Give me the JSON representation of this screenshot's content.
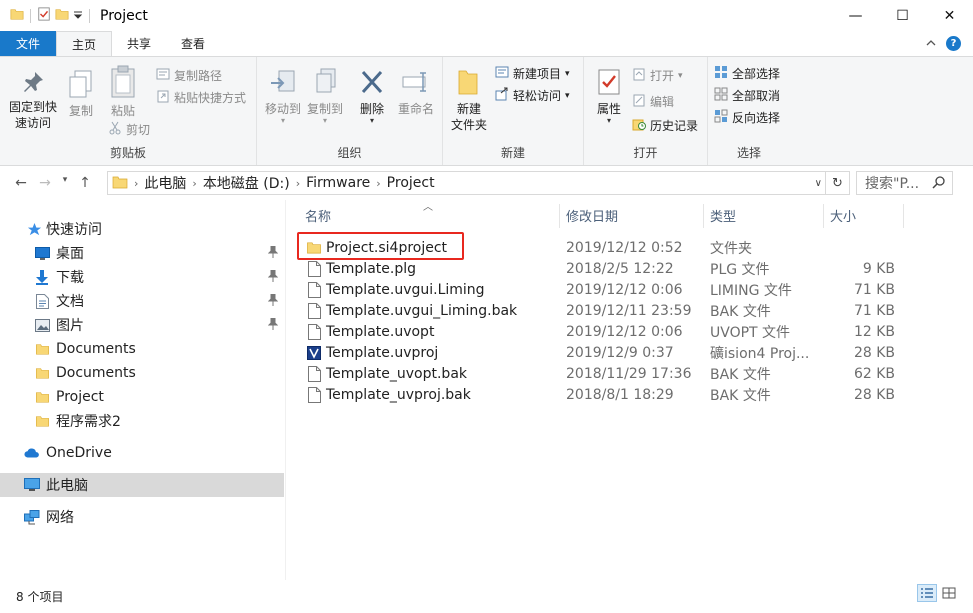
{
  "window": {
    "title": "Project",
    "minimize": "—",
    "maximize": "☐",
    "close": "✕"
  },
  "tabs": {
    "file": "文件",
    "home": "主页",
    "share": "共享",
    "view": "查看"
  },
  "ribbon": {
    "clipboard": {
      "label": "剪贴板",
      "pin": "固定到快速访问",
      "pin_line1": "固定到快",
      "pin_line2": "速访问",
      "copy": "复制",
      "paste": "粘贴",
      "copy_path": "复制路径",
      "paste_shortcut": "粘贴快捷方式",
      "cut": "剪切"
    },
    "organize": {
      "label": "组织",
      "move_to": "移动到",
      "copy_to": "复制到",
      "delete": "删除",
      "rename": "重命名"
    },
    "new": {
      "label": "新建",
      "new_folder_line1": "新建",
      "new_folder_line2": "文件夹",
      "new_item": "新建项目",
      "easy_access": "轻松访问"
    },
    "open": {
      "label": "打开",
      "properties": "属性",
      "open": "打开",
      "edit": "编辑",
      "history": "历史记录"
    },
    "select": {
      "label": "选择",
      "select_all": "全部选择",
      "select_none": "全部取消",
      "invert": "反向选择"
    }
  },
  "address": {
    "crumbs": [
      "此电脑",
      "本地磁盘 (D:)",
      "Firmware",
      "Project"
    ],
    "search_placeholder": "搜索\"P..."
  },
  "nav": {
    "quick_access": "快速访问",
    "items": [
      {
        "label": "桌面",
        "icon": "desktop-icon",
        "pinned": true
      },
      {
        "label": "下载",
        "icon": "download-icon",
        "pinned": true
      },
      {
        "label": "文档",
        "icon": "document-icon",
        "pinned": true
      },
      {
        "label": "图片",
        "icon": "picture-icon",
        "pinned": true
      },
      {
        "label": "Documents",
        "icon": "folder-icon",
        "pinned": false
      },
      {
        "label": "Documents",
        "icon": "folder-icon",
        "pinned": false
      },
      {
        "label": "Project",
        "icon": "folder-icon",
        "pinned": false
      },
      {
        "label": "程序需求2",
        "icon": "folder-icon",
        "pinned": false
      }
    ],
    "onedrive": "OneDrive",
    "this_pc": "此电脑",
    "network": "网络"
  },
  "columns": {
    "name": "名称",
    "date": "修改日期",
    "type": "类型",
    "size": "大小"
  },
  "files": [
    {
      "name": "Project.si4project",
      "date": "2019/12/12 0:52",
      "type": "文件夹",
      "size": "",
      "icon": "folder-icon"
    },
    {
      "name": "Template.plg",
      "date": "2018/2/5 12:22",
      "type": "PLG 文件",
      "size": "9 KB",
      "icon": "file-icon"
    },
    {
      "name": "Template.uvgui.Liming",
      "date": "2019/12/12 0:06",
      "type": "LIMING 文件",
      "size": "71 KB",
      "icon": "file-icon"
    },
    {
      "name": "Template.uvgui_Liming.bak",
      "date": "2019/12/11 23:59",
      "type": "BAK 文件",
      "size": "71 KB",
      "icon": "file-icon"
    },
    {
      "name": "Template.uvopt",
      "date": "2019/12/12 0:06",
      "type": "UVOPT 文件",
      "size": "12 KB",
      "icon": "file-icon"
    },
    {
      "name": "Template.uvproj",
      "date": "2019/12/9 0:37",
      "type": "礦ision4 Proj...",
      "size": "28 KB",
      "icon": "uvision-icon"
    },
    {
      "name": "Template_uvopt.bak",
      "date": "2018/11/29 17:36",
      "type": "BAK 文件",
      "size": "62 KB",
      "icon": "file-icon"
    },
    {
      "name": "Template_uvproj.bak",
      "date": "2018/8/1 18:29",
      "type": "BAK 文件",
      "size": "28 KB",
      "icon": "file-icon"
    }
  ],
  "status": {
    "count": "8 个项目"
  },
  "colors": {
    "accent": "#1979ca",
    "highlight_box": "#e8281f",
    "folder": "#f8d775"
  }
}
